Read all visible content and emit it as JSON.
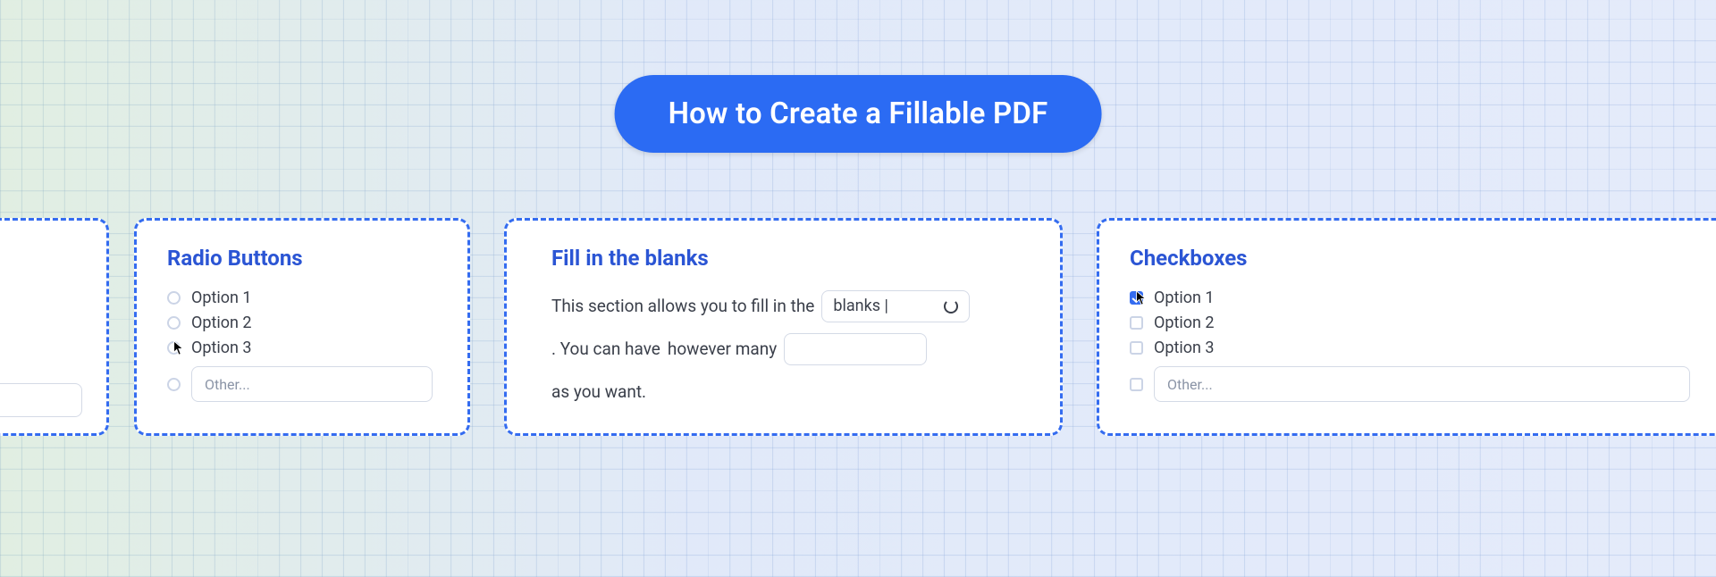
{
  "header": {
    "title": "How to Create a Fillable PDF"
  },
  "cards": {
    "radio": {
      "title": "Radio Buttons",
      "options": [
        "Option 1",
        "Option 2",
        "Option 3"
      ],
      "other_placeholder": "Other..."
    },
    "fill": {
      "title": "Fill in the blanks",
      "text_parts": {
        "p1": "This section allows you to fill in the",
        "input1_value": "blanks",
        "p2": ". You can have",
        "p3": "however many",
        "p4": "as you want."
      }
    },
    "check": {
      "title": "Checkboxes",
      "options": [
        "Option 1",
        "Option 2",
        "Option 3"
      ],
      "other_placeholder": "Other..."
    }
  }
}
